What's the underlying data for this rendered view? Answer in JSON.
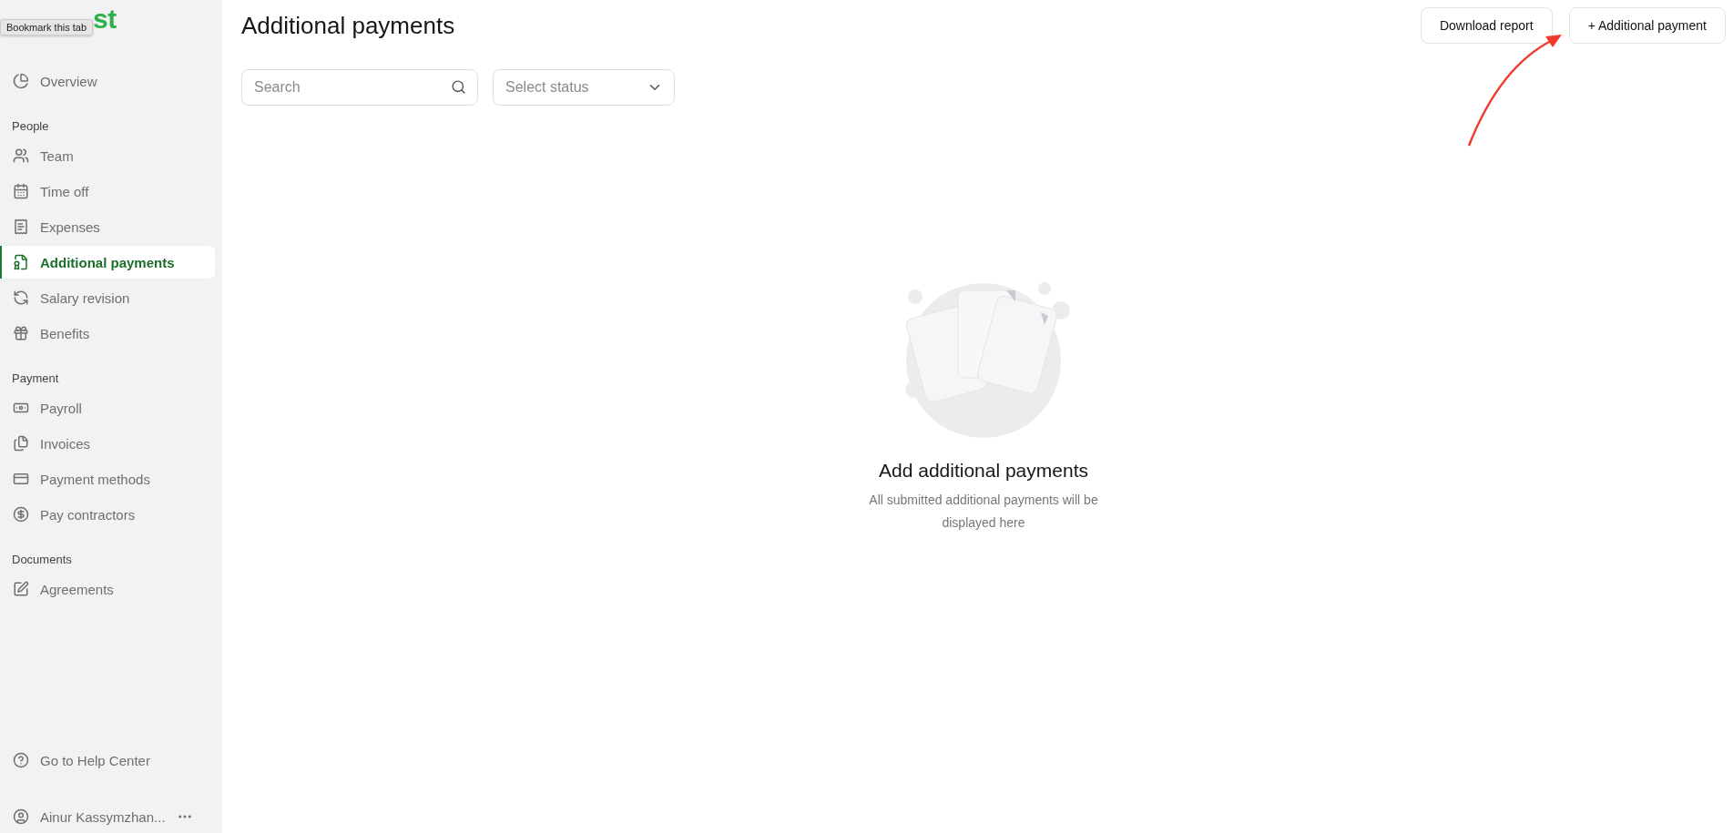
{
  "logo": "st",
  "tooltip": "Bookmark this tab",
  "sidebar": {
    "sections": [
      {
        "items": [
          {
            "label": "Overview",
            "selected": false
          }
        ]
      },
      {
        "heading": "People",
        "items": [
          {
            "label": "Team",
            "selected": false
          },
          {
            "label": "Time off",
            "selected": false
          },
          {
            "label": "Expenses",
            "selected": false
          },
          {
            "label": "Additional payments",
            "selected": true
          },
          {
            "label": "Salary revision",
            "selected": false
          },
          {
            "label": "Benefits",
            "selected": false
          }
        ]
      },
      {
        "heading": "Payment",
        "items": [
          {
            "label": "Payroll",
            "selected": false
          },
          {
            "label": "Invoices",
            "selected": false
          },
          {
            "label": "Payment methods",
            "selected": false
          },
          {
            "label": "Pay contractors",
            "selected": false
          }
        ]
      },
      {
        "heading": "Documents",
        "items": [
          {
            "label": "Agreements",
            "selected": false
          }
        ]
      }
    ],
    "help": "Go to Help Center",
    "user": "Ainur Kassymzhan..."
  },
  "page": {
    "title": "Additional payments",
    "buttons": [
      "Download report",
      "+ Additional payment"
    ],
    "search": {
      "placeholder": "Search"
    },
    "status_select": {
      "placeholder": "Select status"
    },
    "empty_state": {
      "title": "Add additional payments",
      "text": "All submitted additional payments will be displayed here"
    }
  }
}
